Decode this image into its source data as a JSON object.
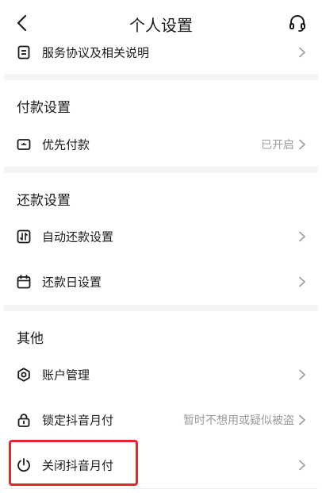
{
  "header": {
    "title": "个人设置",
    "back_icon": "chevron-left-icon",
    "support_icon": "headset-icon"
  },
  "rows": {
    "service_agreement": {
      "label": "服务协议及相关说明",
      "icon": "document-icon"
    },
    "priority_pay": {
      "label": "优先付款",
      "value": "已开启",
      "icon": "wallet-icon"
    },
    "auto_repay": {
      "label": "自动还款设置",
      "icon": "auto-repay-icon"
    },
    "repay_day": {
      "label": "还款日设置",
      "icon": "calendar-icon"
    },
    "account_manage": {
      "label": "账户管理",
      "icon": "hexagon-gear-icon"
    },
    "lock_pay": {
      "label": "锁定抖音月付",
      "value": "暂时不想用或疑似被盗",
      "icon": "lock-icon"
    },
    "close_pay": {
      "label": "关闭抖音月付",
      "icon": "power-icon"
    }
  },
  "sections": {
    "payment": "付款设置",
    "repayment": "还款设置",
    "other": "其他"
  },
  "colors": {
    "highlight": "#e5242b",
    "secondary_text": "#9a9a9a",
    "divider": "#f4f4f5"
  }
}
